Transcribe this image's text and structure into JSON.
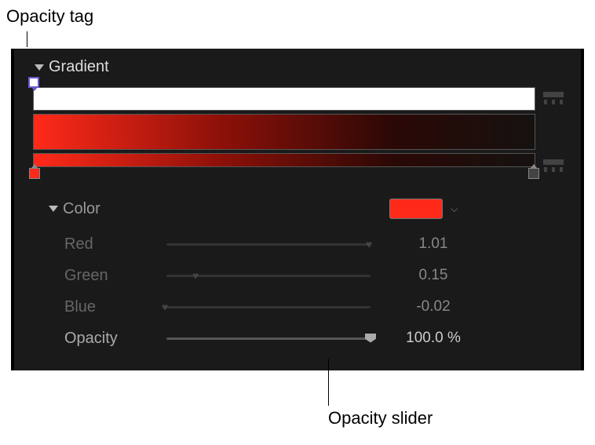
{
  "callouts": {
    "top": "Opacity tag",
    "bottom": "Opacity slider"
  },
  "panel": {
    "title": "Gradient"
  },
  "gradient": {
    "opacity_tag_color": "#ffffff",
    "stops": {
      "left_color": "#ff2a1a",
      "right_color": "#151210"
    }
  },
  "color_section": {
    "title": "Color",
    "swatch": "#ff2a1a",
    "params": {
      "red": {
        "label": "Red",
        "value": "1.01",
        "pos_pct": 100
      },
      "green": {
        "label": "Green",
        "value": "0.15",
        "pos_pct": 15
      },
      "blue": {
        "label": "Blue",
        "value": "-0.02",
        "pos_pct": 0
      },
      "opacity": {
        "label": "Opacity",
        "value": "100.0 %",
        "pos_pct": 100
      }
    }
  }
}
